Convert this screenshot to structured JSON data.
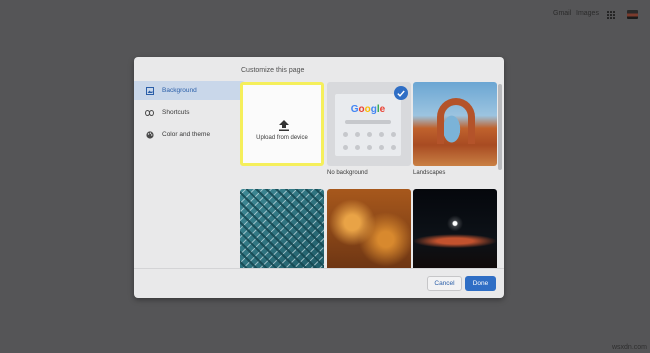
{
  "topbar": {
    "gmail": "Gmail",
    "images": "Images"
  },
  "dialog": {
    "title": "Customize this page",
    "nav": [
      {
        "label": "Background",
        "icon": "image-icon",
        "active": true
      },
      {
        "label": "Shortcuts",
        "icon": "link-icon"
      },
      {
        "label": "Color and theme",
        "icon": "palette-icon"
      }
    ],
    "tiles": {
      "upload": "Upload from device",
      "no_background": "No background",
      "landscapes": "Landscapes",
      "google_logo": "Google"
    },
    "buttons": {
      "cancel": "Cancel",
      "done": "Done"
    },
    "accent": "#2f6ec5",
    "highlight": "#f5ef5b"
  },
  "watermark": "wsxdn.com"
}
